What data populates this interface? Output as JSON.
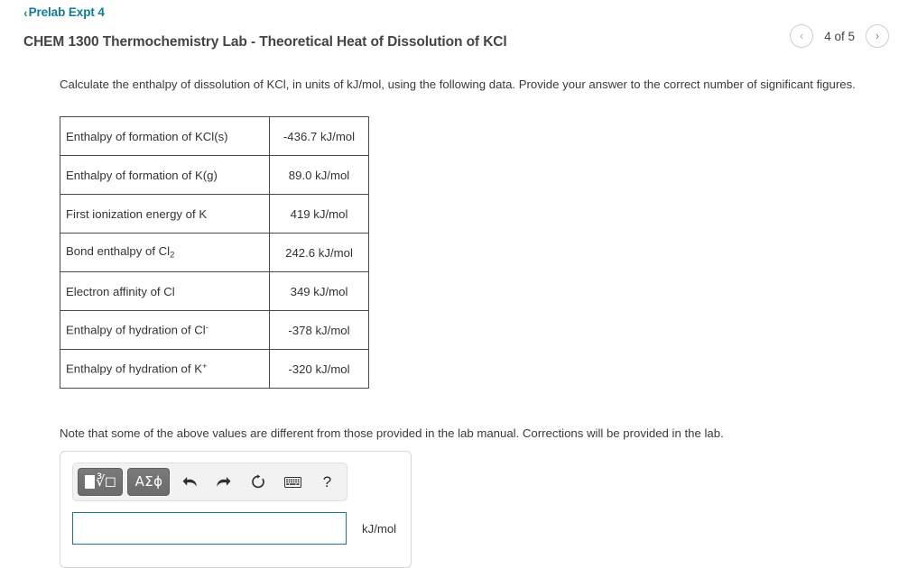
{
  "breadcrumb": {
    "back_label": "Prelab Expt 4",
    "chevron": "‹"
  },
  "header": {
    "title": "CHEM 1300 Thermochemistry Lab - Theoretical Heat of Dissolution of KCl",
    "pager": {
      "prev_glyph": "‹",
      "label": "4 of 5",
      "next_glyph": "›",
      "current": 4,
      "total": 5
    }
  },
  "main": {
    "prompt": "Calculate the enthalpy of dissolution of KCl, in units of kJ/mol, using the following data. Provide your answer to the correct number of significant figures.",
    "note": "Note that some of the above values are different from those provided in the lab manual. Corrections will be provided in the lab.",
    "table": {
      "rows": [
        {
          "label": "Enthalpy of formation of KCl(s)",
          "value": "-436.7 kJ/mol"
        },
        {
          "label": "Enthalpy of formation of K(g)",
          "value": "89.0 kJ/mol"
        },
        {
          "label": "First ionization energy of K",
          "value": "419 kJ/mol"
        },
        {
          "label": "Bond enthalpy of Cl2",
          "label_base": "Bond enthalpy of Cl",
          "label_sub": "2",
          "value": "242.6 kJ/mol"
        },
        {
          "label": "Electron affinity of Cl",
          "value": "349 kJ/mol"
        },
        {
          "label": "Enthalpy of hydration of Cl-",
          "label_base": "Enthalpy of hydration of Cl",
          "label_sup": "-",
          "value": "-378 kJ/mol"
        },
        {
          "label": "Enthalpy of hydration of K+",
          "label_base": "Enthalpy of hydration of K",
          "label_sup": "+",
          "value": "-320 kJ/mol"
        }
      ]
    }
  },
  "answer": {
    "toolbar": {
      "math_tab_label": "√",
      "greek_tab_label": "ΑΣϕ",
      "undo_name": "undo-icon",
      "redo_name": "redo-icon",
      "reset_name": "reset-icon",
      "keyboard_name": "keyboard-icon",
      "help_label": "?"
    },
    "input_value": "",
    "input_placeholder": "",
    "units": "kJ/mol"
  },
  "colors": {
    "link_teal": "#0e7c99",
    "input_border": "#17788f",
    "table_border": "#4a4a4a",
    "toolbar_bg": "#f2f2f2",
    "tab_gray": "#6b6b6b"
  }
}
